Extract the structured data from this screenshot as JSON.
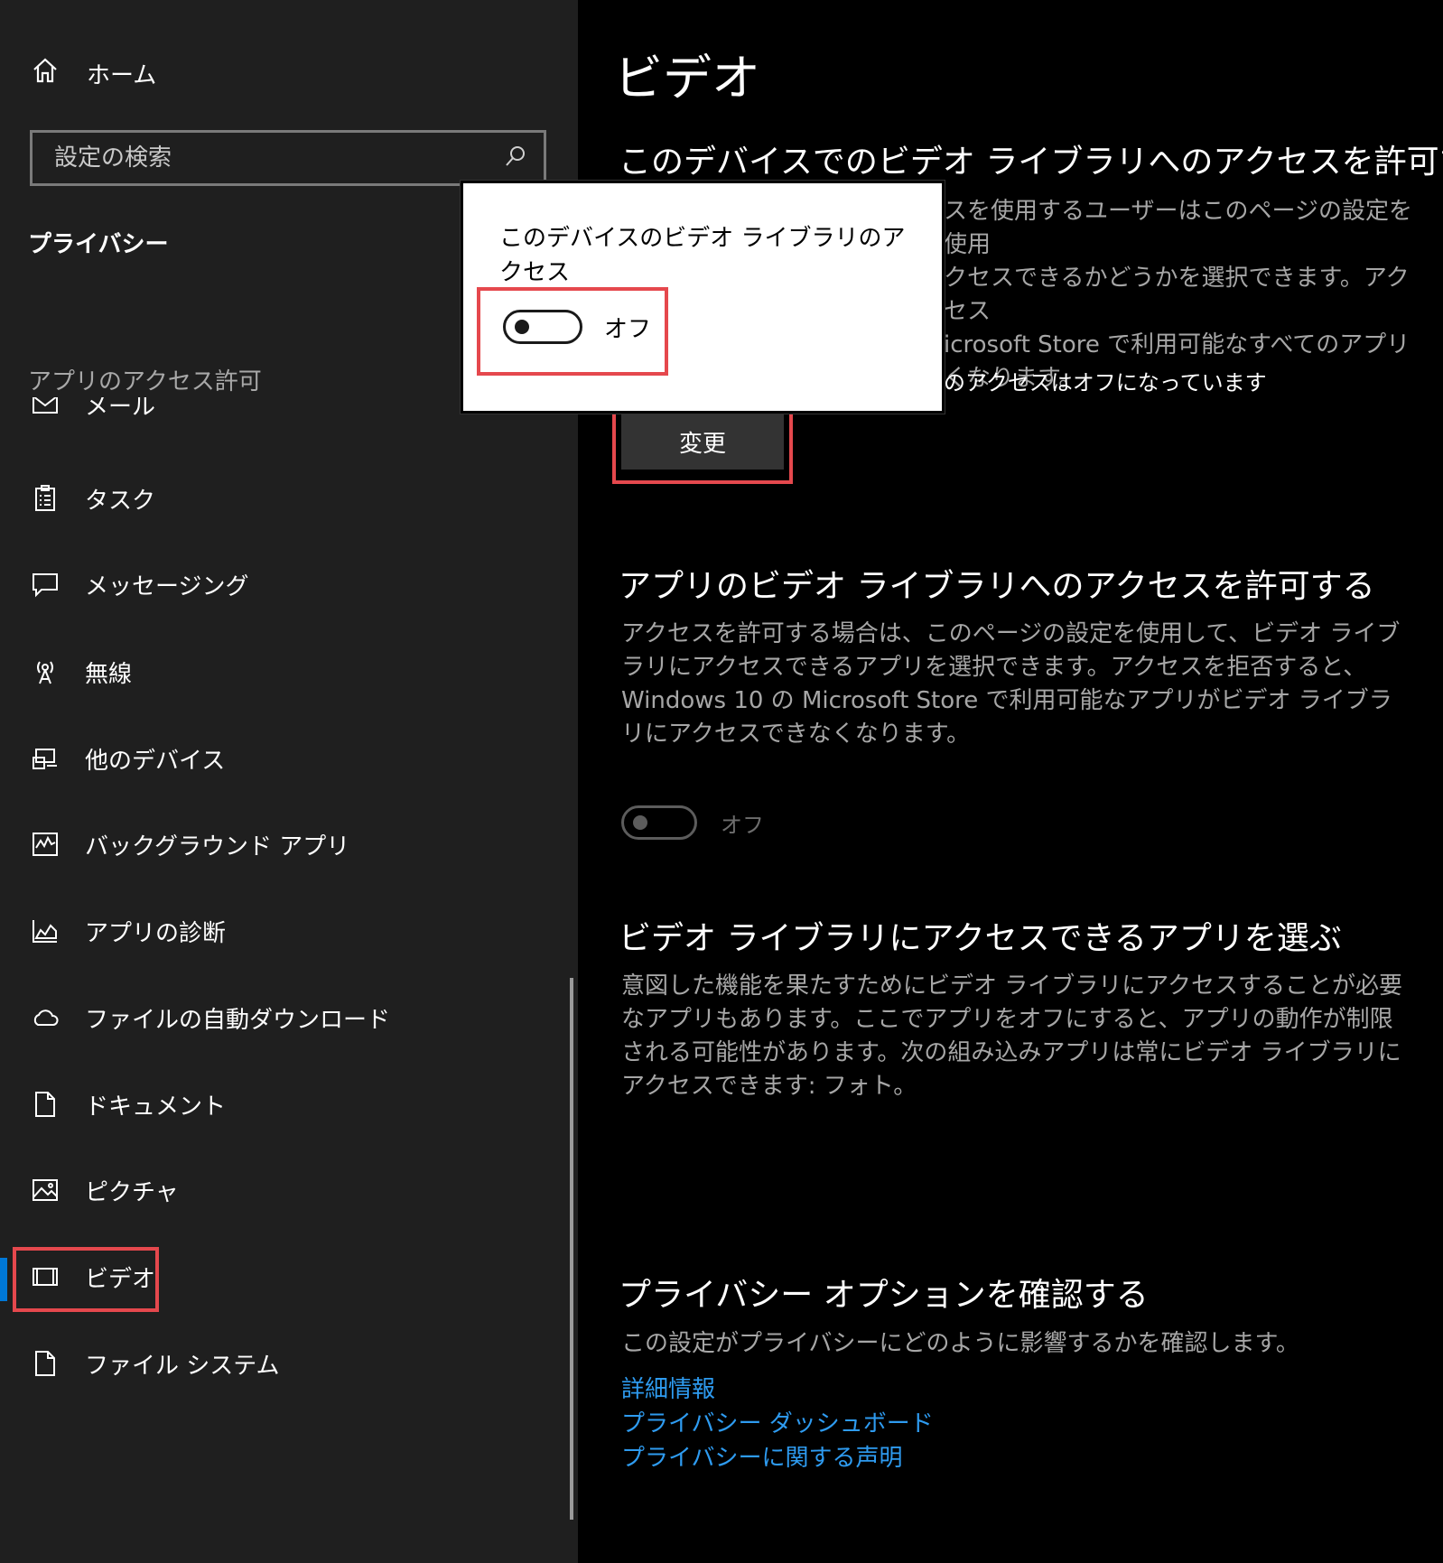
{
  "sidebar": {
    "home_label": "ホーム",
    "search_placeholder": "設定の検索",
    "section_title": "プライバシー",
    "group_title": "アプリのアクセス許可",
    "items": [
      {
        "label": "メール",
        "icon": "mail-icon"
      },
      {
        "label": "タスク",
        "icon": "tasks-icon"
      },
      {
        "label": "メッセージング",
        "icon": "messaging-icon"
      },
      {
        "label": "無線",
        "icon": "radio-icon"
      },
      {
        "label": "他のデバイス",
        "icon": "other-devices-icon"
      },
      {
        "label": "バックグラウンド アプリ",
        "icon": "background-apps-icon"
      },
      {
        "label": "アプリの診断",
        "icon": "app-diagnostics-icon"
      },
      {
        "label": "ファイルの自動ダウンロード",
        "icon": "cloud-icon"
      },
      {
        "label": "ドキュメント",
        "icon": "document-icon"
      },
      {
        "label": "ピクチャ",
        "icon": "picture-icon"
      },
      {
        "label": "ビデオ",
        "icon": "video-icon",
        "selected": true
      },
      {
        "label": "ファイル システム",
        "icon": "file-system-icon"
      }
    ],
    "accent_color": "#0078d7"
  },
  "main": {
    "title": "ビデオ",
    "device_access": {
      "heading": "このデバイスでのビデオ ライブラリへのアクセスを許可する",
      "desc_line1": "スを使用するユーザーはこのページの設定を使用",
      "desc_line2": "クセスできるかどうかを選択できます。アクセス",
      "desc_line3": "icrosoft Store で利用可能なすべてのアプリ",
      "desc_line4": "くなります。",
      "status": "のアクセスはオフになっています",
      "change_button": "変更"
    },
    "app_access": {
      "heading": "アプリのビデオ ライブラリへのアクセスを許可する",
      "desc": "アクセスを許可する場合は、このページの設定を使用して、ビデオ ライブラリにアクセスできるアプリを選択できます。アクセスを拒否すると、Windows 10 の Microsoft Store で利用可能なアプリがビデオ ライブラリにアクセスできなくなります。",
      "toggle_label": "オフ",
      "toggle_on": false
    },
    "choose_apps": {
      "heading": "ビデオ ライブラリにアクセスできるアプリを選ぶ",
      "desc": "意図した機能を果たすためにビデオ ライブラリにアクセスすることが必要なアプリもあります。ここでアプリをオフにすると、アプリの動作が制限される可能性があります。次の組み込みアプリは常にビデオ ライブラリにアクセスできます: フォト。"
    },
    "privacy_options": {
      "heading": "プライバシー オプションを確認する",
      "desc": "この設定がプライバシーにどのように影響するかを確認します。",
      "links": [
        "詳細情報",
        "プライバシー ダッシュボード",
        "プライバシーに関する声明"
      ],
      "link_color": "#2e9bf0"
    }
  },
  "flyout": {
    "title": "このデバイスのビデオ ライブラリのアクセス",
    "toggle_label": "オフ",
    "toggle_on": false
  },
  "highlight_color": "#e5484d"
}
